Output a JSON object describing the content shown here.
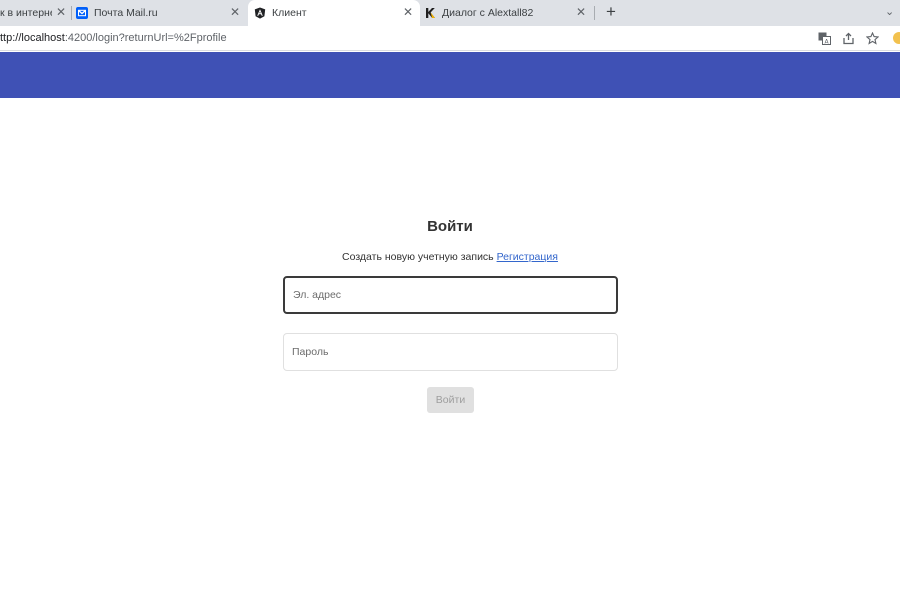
{
  "browser": {
    "tabs": [
      {
        "title": "к в интернет",
        "icon": "generic-page-icon"
      },
      {
        "title": "Почта Mail.ru",
        "icon": "mail-ru-icon"
      },
      {
        "title": "Клиент",
        "icon": "angular-icon",
        "active": true
      },
      {
        "title": "Диалог с Alextall82",
        "icon": "kwork-k-icon"
      }
    ],
    "close_glyph": "✕",
    "new_tab_glyph": "+",
    "tab_search_glyph": "⌄",
    "url_host": "ttp://localhost",
    "url_rest": ":4200/login?returnUrl=%2Fprofile",
    "toolbar_icons": [
      "translate-icon",
      "share-icon",
      "bookmark-star-icon",
      "profile-icon"
    ],
    "colors": {
      "tabstrip": "#dee1e6",
      "active_tab": "#ffffff"
    }
  },
  "app": {
    "header_color": "#3f51b5"
  },
  "login": {
    "title": "Войти",
    "subtitle_text": "Создать новую учетную запись",
    "register_link": "Регистрация",
    "email_placeholder": "Эл. адрес",
    "password_placeholder": "Пароль",
    "submit_label": "Войти",
    "submit_disabled": true
  }
}
